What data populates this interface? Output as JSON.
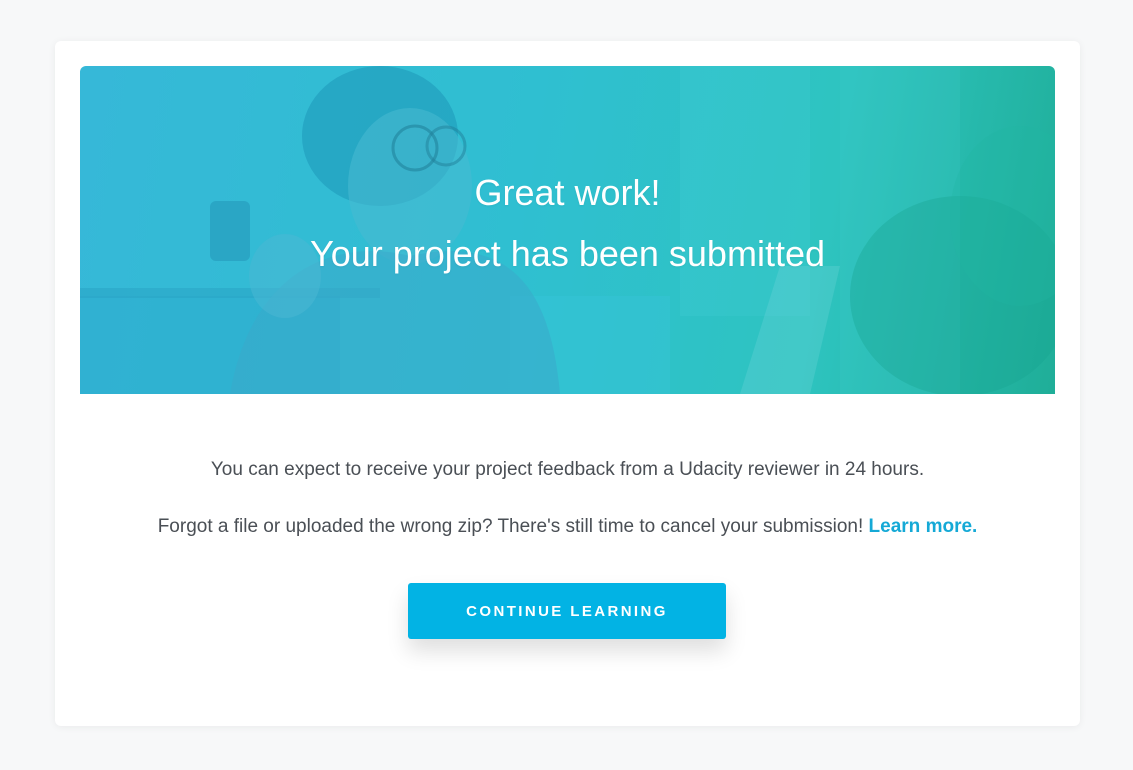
{
  "hero": {
    "title_line1": "Great work!",
    "title_line2": "Your project has been submitted"
  },
  "message": {
    "feedback_text": "You can expect to receive your project feedback from a Udacity reviewer in 24 hours.",
    "cancel_text": "Forgot a file or uploaded the wrong zip? There's still time to cancel your submission!",
    "learn_more_link": "Learn more."
  },
  "actions": {
    "continue_label": "CONTINUE LEARNING"
  },
  "colors": {
    "accent": "#02b3e4",
    "link": "#15a9d6",
    "hero_start": "#36b8d8",
    "hero_end": "#1fae98"
  }
}
